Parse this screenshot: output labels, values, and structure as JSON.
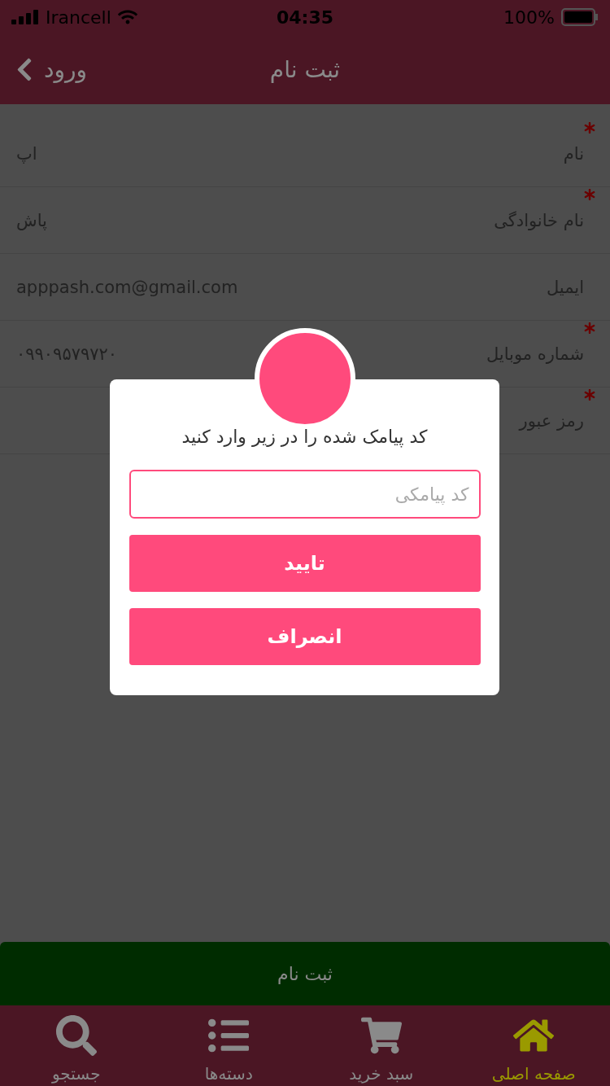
{
  "status_bar": {
    "carrier": "Irancell",
    "time": "04:35",
    "battery": "100%"
  },
  "nav": {
    "title": "ثبت نام",
    "back": "ورود"
  },
  "fields": [
    {
      "label": "نام",
      "value": "اپ",
      "required": true
    },
    {
      "label": "نام خانوادگی",
      "value": "پاش",
      "required": true
    },
    {
      "label": "ایمیل",
      "value": "apppash.com@gmail.com",
      "required": false
    },
    {
      "label": "شماره موبایل",
      "value": "۰۹۹۰۹۵۷۹۷۲۰",
      "required": true
    },
    {
      "label": "رمز عبور",
      "required": true
    }
  ],
  "submit_button": "ثبت نام",
  "tabs": [
    {
      "label": "صفحه اصلی",
      "kind": "home",
      "selected": true
    },
    {
      "label": "سبد خرید",
      "kind": "cart",
      "selected": false
    },
    {
      "label": "دسته‌ها",
      "kind": "list",
      "selected": false
    },
    {
      "label": "جستجو",
      "kind": "search",
      "selected": false
    }
  ],
  "dialog": {
    "message": "کد پیامک شده را در زیر وارد کنید",
    "placeholder": "کد پیامکی",
    "buttons": [
      "تایید",
      "انصراف"
    ]
  }
}
